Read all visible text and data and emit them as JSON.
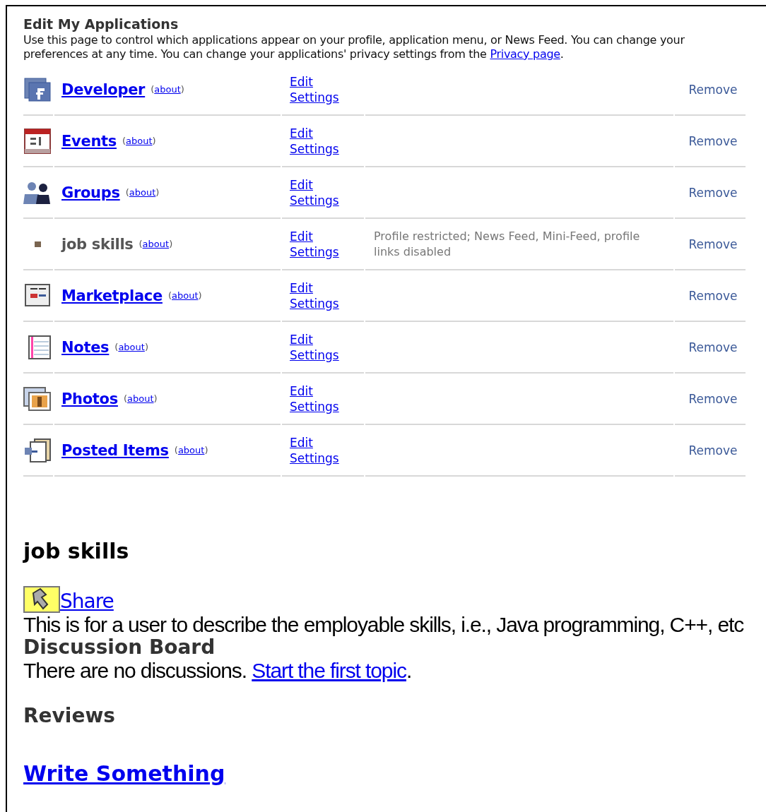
{
  "header": {
    "title": "Edit My Applications",
    "description_before_link": "Use this page to control which applications appear on your profile, application menu, or News Feed. You can change your preferences at any time. You can change your applications' privacy settings from the",
    "privacy_link": "Privacy page",
    "description_after_link": "."
  },
  "applications": [
    {
      "name": "Developer",
      "about_open": "(",
      "about": "about",
      "about_close": ")",
      "edit": "Edit",
      "settings": "Settings",
      "disabled": false,
      "remove": "Remove"
    },
    {
      "name": "Events",
      "about_open": "(",
      "about": "about",
      "about_close": ")",
      "edit": "Edit",
      "settings": "Settings",
      "disabled": false,
      "remove": "Remove"
    },
    {
      "name": "Groups",
      "about_open": "(",
      "about": "about",
      "about_close": ")",
      "edit": "Edit",
      "settings": "Settings",
      "disabled": false,
      "remove": "Remove"
    },
    {
      "name": "job skills",
      "about_open": "(",
      "about": "about",
      "about_close": ")",
      "edit": "Edit",
      "settings": "Settings",
      "disabled": true,
      "status": "Profile restricted; News Feed, Mini-Feed, profile links disabled",
      "remove": "Remove"
    },
    {
      "name": "Marketplace",
      "about_open": "(",
      "about": "about",
      "about_close": ")",
      "edit": "Edit",
      "settings": "Settings",
      "disabled": false,
      "remove": "Remove"
    },
    {
      "name": "Notes",
      "about_open": "(",
      "about": "about",
      "about_close": ")",
      "edit": "Edit",
      "settings": "Settings",
      "disabled": false,
      "remove": "Remove"
    },
    {
      "name": "Photos",
      "about_open": "(",
      "about": "about",
      "about_close": ")",
      "edit": "Edit",
      "settings": "Settings",
      "disabled": false,
      "remove": "Remove"
    },
    {
      "name": "Posted Items",
      "about_open": "(",
      "about": "about",
      "about_close": ")",
      "edit": "Edit",
      "settings": "Settings",
      "disabled": false,
      "remove": "Remove"
    }
  ],
  "app_detail": {
    "title": "job skills",
    "share": "Share",
    "description": "This is for a user to describe the employable skills, i.e., Java programming, C++, etc",
    "discussion_title": "Discussion Board",
    "discussion_text": "There are no discussions.",
    "discussion_link": "Start the first topic",
    "discussion_after_link": ".",
    "reviews_title": "Reviews",
    "write_link": "Write Something"
  }
}
